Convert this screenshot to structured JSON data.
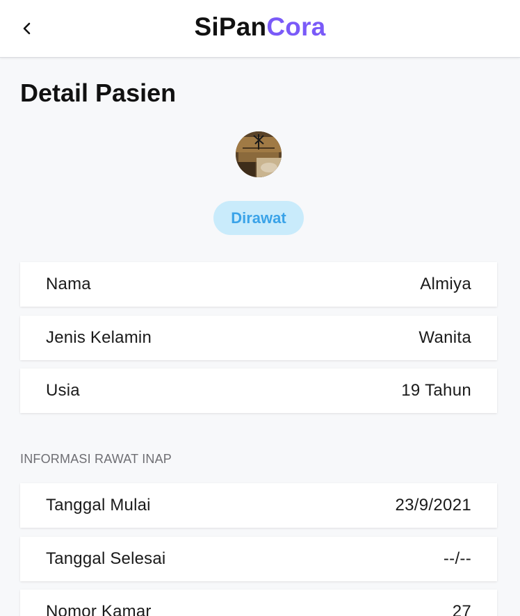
{
  "header": {
    "brand_part1": "SiPan",
    "brand_part2": "Cora",
    "brand_accent_color": "#7a5af8",
    "back_icon": "chevron-left-icon"
  },
  "page": {
    "title": "Detail Pasien"
  },
  "patient": {
    "avatar": "patient-avatar-photo",
    "status": "Dirawat",
    "status_color": "#3aa3e8",
    "fields": [
      {
        "label": "Nama",
        "value": "Almiya"
      },
      {
        "label": "Jenis Kelamin",
        "value": "Wanita"
      },
      {
        "label": "Usia",
        "value": "19 Tahun"
      }
    ]
  },
  "inpatient": {
    "section_title": "INFORMASI RAWAT INAP",
    "fields": [
      {
        "label": "Tanggal Mulai",
        "value": "23/9/2021"
      },
      {
        "label": "Tanggal Selesai",
        "value": "--/--"
      },
      {
        "label": "Nomor Kamar",
        "value": "27"
      }
    ]
  }
}
